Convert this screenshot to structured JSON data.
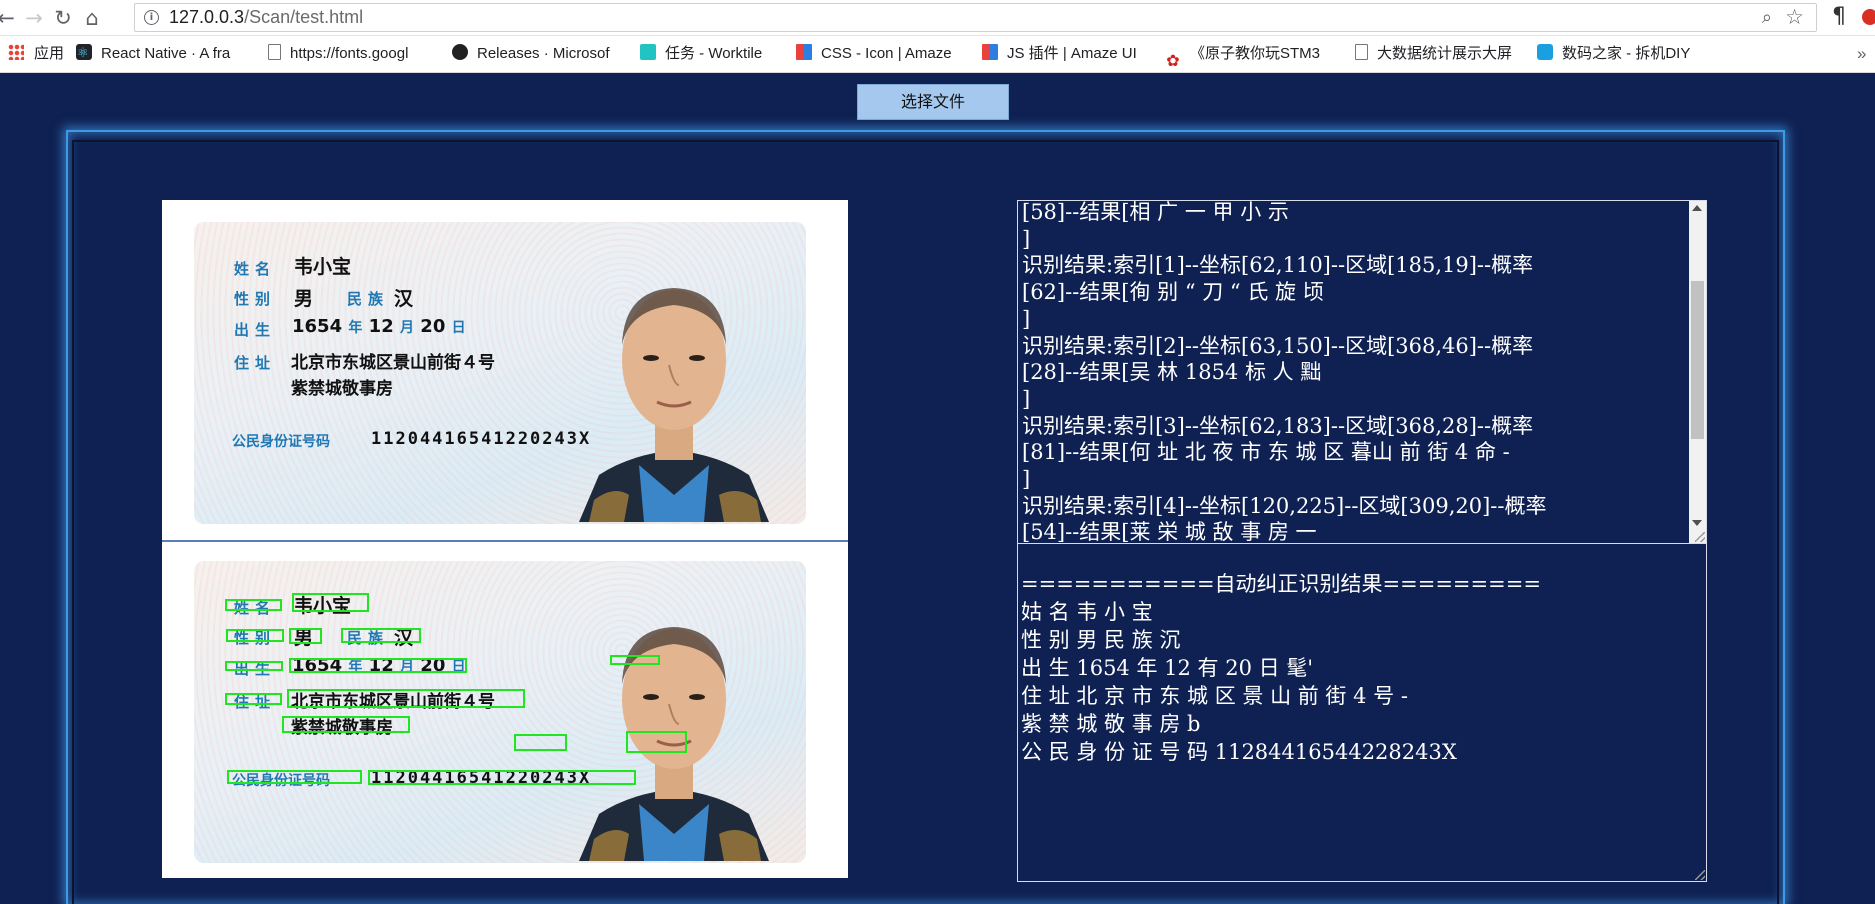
{
  "browser": {
    "url_host": "127.0.0.3",
    "url_path": "/Scan/test.html",
    "bookmarks": [
      {
        "label": "应用",
        "icon": "apps-grid-icon"
      },
      {
        "label": "React Native · A fra",
        "icon": "react-icon"
      },
      {
        "label": "https://fonts.googl",
        "icon": "page-icon"
      },
      {
        "label": "Releases · Microsof",
        "icon": "github-icon"
      },
      {
        "label": "任务 - Worktile",
        "icon": "worktile-icon"
      },
      {
        "label": "CSS - Icon | Amaze",
        "icon": "amaze-icon"
      },
      {
        "label": "JS 插件 | Amaze UI",
        "icon": "amaze-icon"
      },
      {
        "label": "《原子教你玩STM3",
        "icon": "stm-icon"
      },
      {
        "label": "大数据统计展示大屏",
        "icon": "page-icon"
      },
      {
        "label": "数码之家 - 拆机DIY",
        "icon": "mydrivers-icon"
      }
    ]
  },
  "page": {
    "choose_file_label": "选择文件",
    "card": {
      "name_label": "姓名",
      "name_value": "韦小宝",
      "gender_label": "性别",
      "gender_value": "男",
      "ethnic_label": "民族",
      "ethnic_value": "汉",
      "birth_label": "出生",
      "birth_year": "1654",
      "birth_year_unit": "年",
      "birth_month": "12",
      "birth_month_unit": "月",
      "birth_day": "20",
      "birth_day_unit": "日",
      "address_label": "住址",
      "address_line1": "北京市东城区景山前街４号",
      "address_line2": "紫禁城敬事房",
      "id_label": "公民身份证号码",
      "id_number": "11204416541220243X"
    },
    "raw_result_text": "[58]--结果[相 广 一 甲 小 示\n]\n识别结果:索引[1]--坐标[62,110]--区域[185,19]--概率\n[62]--结果[徇 别 “ 刀 “ 氏 旋 顷\n]\n识别结果:索引[2]--坐标[63,150]--区域[368,46]--概率\n[28]--结果[吴 林 1854 标 人 黜\n]\n识别结果:索引[3]--坐标[62,183]--区域[368,28]--概率\n[81]--结果[何 址 北 夜 市 东 城 区 暮山 前 街 4 命 -\n]\n识别结果:索引[4]--坐标[120,225]--区域[309,20]--概率\n[54]--结果[莱 栄 城 敌 事 房 一\n]",
    "corrected_result_text": "===========自动纠正识别结果=========\n姑 名 韦 小 宝\n性 别 男 民 族 沉\n出 生 1654 年 12 有 20 日 髦'\n住 址 北 京 市 东 城 区 景 山 前 街 4 号 -\n紫 禁 城 敬 事 房 b\n公 民 身 份 证 号 码 11284416544228243X"
  },
  "colors": {
    "page_bg": "#0f2152",
    "frame_glow": "#3d9be6",
    "button_bg": "#a4c8ee",
    "detection_box": "#21e521",
    "card_label": "#1f78b4"
  }
}
